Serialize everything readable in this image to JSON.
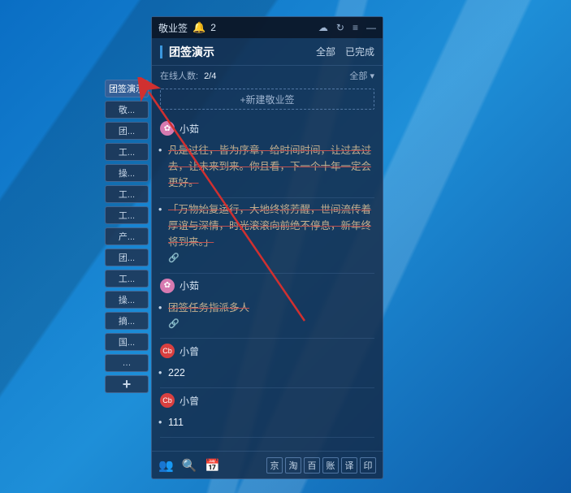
{
  "titlebar": {
    "app_name": "敬业签",
    "notification_count": "2"
  },
  "header": {
    "title": "团签演示",
    "filter_all": "全部",
    "filter_done": "已完成"
  },
  "subheader": {
    "online_label": "在线人数:",
    "online_count": "2/4",
    "dropdown": "全部 ▾"
  },
  "new_note": {
    "placeholder": "+新建敬业签"
  },
  "sidebar": {
    "tabs": [
      "团签演示",
      "敬...",
      "团...",
      "工...",
      "操...",
      "工...",
      "工...",
      "产...",
      "团...",
      "工...",
      "操...",
      "摘...",
      "国...",
      "…"
    ],
    "add": "+"
  },
  "notes": {
    "user1": {
      "name": "小茹",
      "avatar_type": "flower",
      "avatar_glyph": "✿"
    },
    "user2": {
      "name": "小曾",
      "avatar_type": "red",
      "avatar_glyph": "Cb"
    },
    "items": [
      {
        "text": "凡是过往，皆为序章，给时间时间，让过去过去，让未来到来。你且看，下一个十年一定会更好。"
      },
      {
        "text": "「万物始复运行，大地终将芳醒，世间流传着厚谊与深情，时光滚滚向前绝不停息，新年终将到来。」"
      },
      {
        "text": "团签任务指派多人"
      },
      {
        "text": "222"
      },
      {
        "text": "111"
      }
    ]
  },
  "bottombar": {
    "square_buttons": [
      "京",
      "淘",
      "百",
      "账",
      "译",
      "印"
    ]
  }
}
